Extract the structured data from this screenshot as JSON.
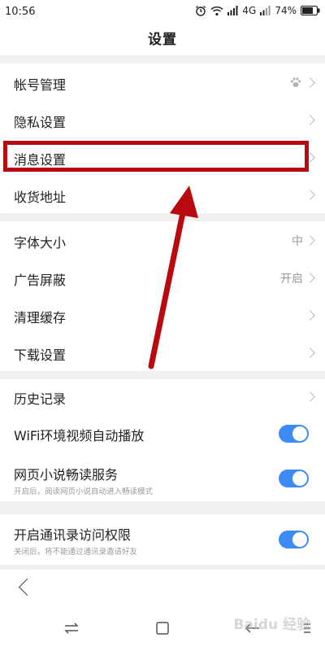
{
  "status_bar": {
    "time": "10:56",
    "network": "4G",
    "battery": "74%"
  },
  "header": {
    "title": "设置"
  },
  "groups": {
    "account": {
      "items": [
        {
          "label": "帐号管理",
          "icon": "paw-icon"
        },
        {
          "label": "隐私设置"
        },
        {
          "label": "消息设置"
        },
        {
          "label": "收货地址"
        }
      ]
    },
    "general": {
      "items": [
        {
          "label": "字体大小",
          "value": "中"
        },
        {
          "label": "广告屏蔽",
          "value": "开启"
        },
        {
          "label": "清理缓存"
        },
        {
          "label": "下载设置"
        }
      ]
    },
    "browsing": {
      "items": [
        {
          "label": "历史记录"
        },
        {
          "label": "WiFi环境视频自动播放",
          "toggle": true
        },
        {
          "label": "网页小说畅读服务",
          "sub": "开启后，阅读网页小说自动进入畅读模式",
          "toggle": true
        }
      ]
    },
    "contacts": {
      "items": [
        {
          "label": "开启通讯录访问权限",
          "sub": "关闭后，将不能通过通讯录邀请好友",
          "toggle": true
        }
      ]
    }
  },
  "colors": {
    "accent": "#3d8cf5",
    "highlight": "#b8090f"
  },
  "watermark": "Baidu 经验"
}
